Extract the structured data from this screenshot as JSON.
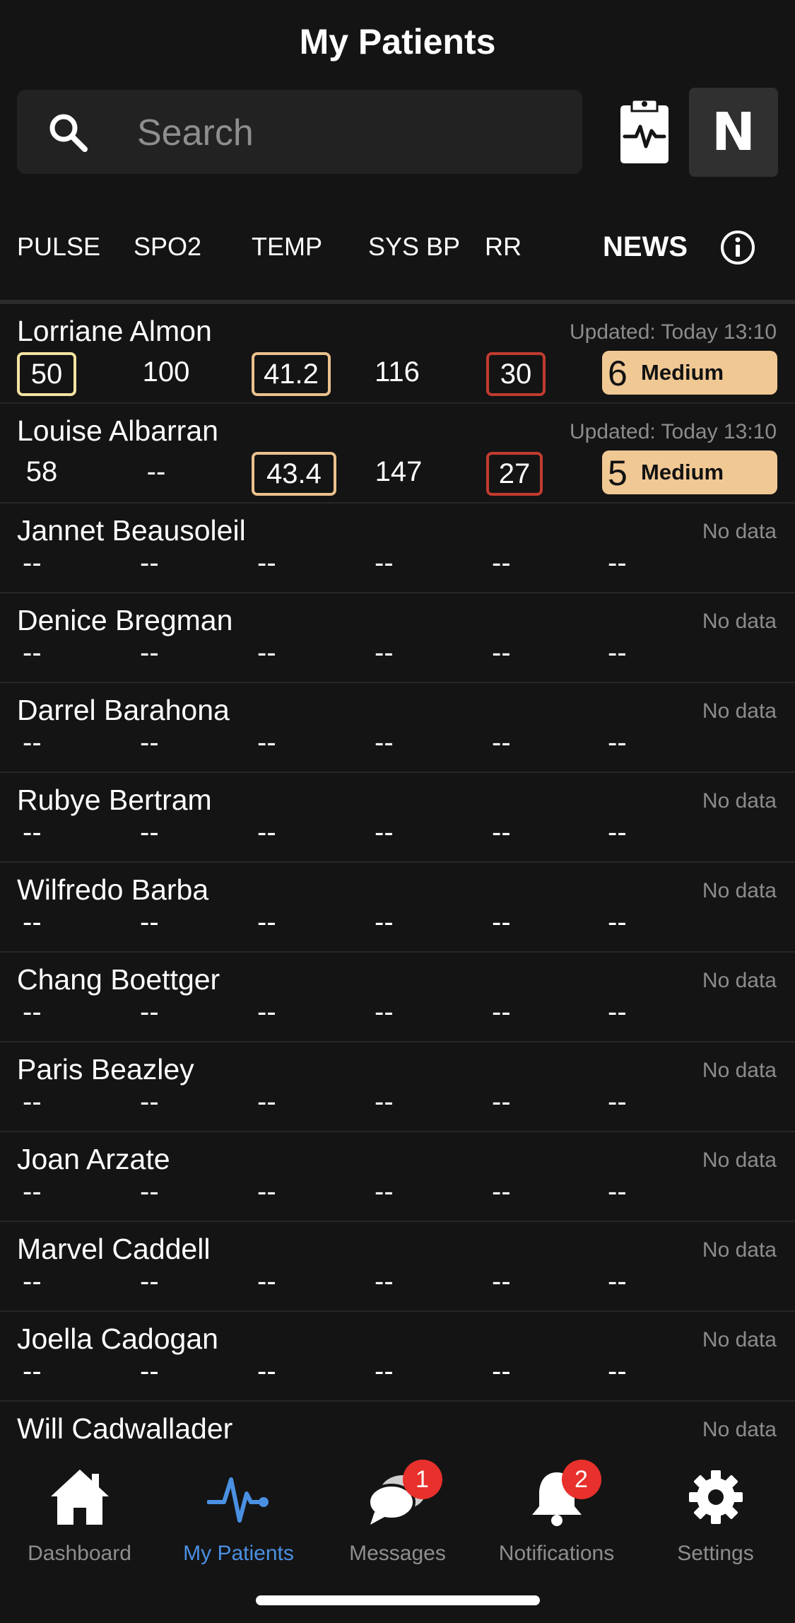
{
  "header": {
    "title": "My Patients"
  },
  "search": {
    "placeholder": "Search"
  },
  "toolbar": {
    "n_label": "N"
  },
  "columns": [
    "PULSE",
    "SPO2",
    "TEMP",
    "SYS BP",
    "RR",
    "NEWS"
  ],
  "patients": [
    {
      "name": "Lorriane Almon",
      "updated": "Updated: Today 13:10",
      "pulse": "50",
      "spo2": "100",
      "temp": "41.2",
      "sysbp": "116",
      "rr": "30",
      "news_score": "6",
      "news_level": "Medium"
    },
    {
      "name": "Louise Albarran",
      "updated": "Updated: Today 13:10",
      "pulse": "58",
      "spo2": "--",
      "temp": "43.4",
      "sysbp": "147",
      "rr": "27",
      "news_score": "5",
      "news_level": "Medium"
    },
    {
      "name": "Jannet Beausoleil",
      "updated": "No data",
      "pulse": "--",
      "spo2": "--",
      "temp": "--",
      "sysbp": "--",
      "rr": "--",
      "news": "--"
    },
    {
      "name": "Denice Bregman",
      "updated": "No data",
      "pulse": "--",
      "spo2": "--",
      "temp": "--",
      "sysbp": "--",
      "rr": "--",
      "news": "--"
    },
    {
      "name": "Darrel Barahona",
      "updated": "No data",
      "pulse": "--",
      "spo2": "--",
      "temp": "--",
      "sysbp": "--",
      "rr": "--",
      "news": "--"
    },
    {
      "name": "Rubye Bertram",
      "updated": "No data",
      "pulse": "--",
      "spo2": "--",
      "temp": "--",
      "sysbp": "--",
      "rr": "--",
      "news": "--"
    },
    {
      "name": "Wilfredo Barba",
      "updated": "No data",
      "pulse": "--",
      "spo2": "--",
      "temp": "--",
      "sysbp": "--",
      "rr": "--",
      "news": "--"
    },
    {
      "name": "Chang Boettger",
      "updated": "No data",
      "pulse": "--",
      "spo2": "--",
      "temp": "--",
      "sysbp": "--",
      "rr": "--",
      "news": "--"
    },
    {
      "name": "Paris Beazley",
      "updated": "No data",
      "pulse": "--",
      "spo2": "--",
      "temp": "--",
      "sysbp": "--",
      "rr": "--",
      "news": "--"
    },
    {
      "name": "Joan Arzate",
      "updated": "No data",
      "pulse": "--",
      "spo2": "--",
      "temp": "--",
      "sysbp": "--",
      "rr": "--",
      "news": "--"
    },
    {
      "name": "Marvel Caddell",
      "updated": "No data",
      "pulse": "--",
      "spo2": "--",
      "temp": "--",
      "sysbp": "--",
      "rr": "--",
      "news": "--"
    },
    {
      "name": "Joella Cadogan",
      "updated": "No data",
      "pulse": "--",
      "spo2": "--",
      "temp": "--",
      "sysbp": "--",
      "rr": "--",
      "news": "--"
    },
    {
      "name": "Will Cadwallader",
      "updated": "No data"
    }
  ],
  "tabs": [
    {
      "label": "Dashboard",
      "icon": "home-icon"
    },
    {
      "label": "My Patients",
      "icon": "heartbeat-icon",
      "active": true
    },
    {
      "label": "Messages",
      "icon": "chat-icon",
      "badge": "1"
    },
    {
      "label": "Notifications",
      "icon": "bell-icon",
      "badge": "2"
    },
    {
      "label": "Settings",
      "icon": "gear-icon"
    }
  ],
  "colors": {
    "background": "#141414",
    "accent": "#4a90e2",
    "news_medium": "#f0c894",
    "alert_red": "#c23b2f",
    "alert_orange": "#eac18d",
    "alert_yellow": "#f4e3a1",
    "badge_red": "#e8302c"
  }
}
